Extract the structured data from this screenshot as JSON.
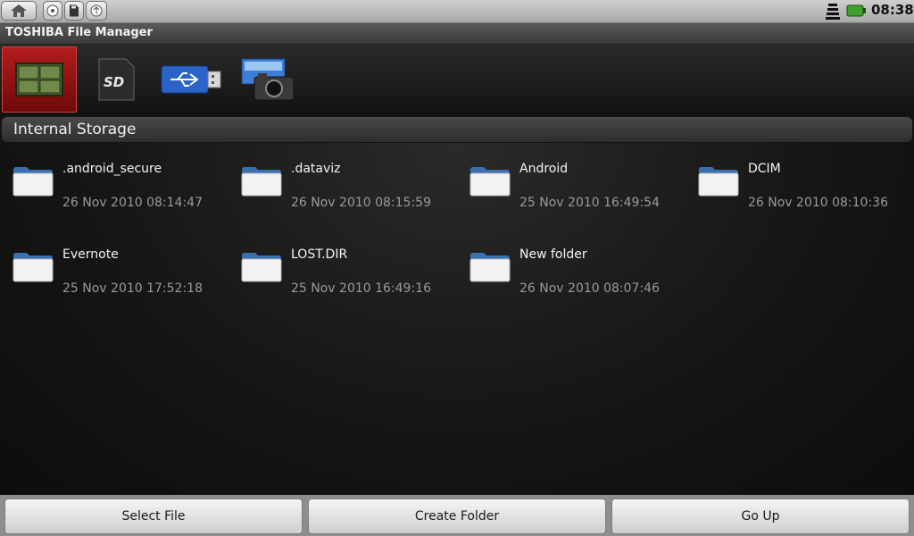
{
  "status_bar": {
    "clock": "08:38",
    "icons": [
      "home-icon",
      "usb-debug-icon",
      "sd-card-icon",
      "usb-connected-icon",
      "wifi-signal-icon",
      "battery-icon"
    ]
  },
  "app": {
    "title": "TOSHIBA File Manager"
  },
  "storage_tabs": [
    {
      "name": "internal-storage",
      "icon": "memory-chip-icon",
      "selected": true
    },
    {
      "name": "sd-card",
      "icon": "sd-card-icon",
      "selected": false
    },
    {
      "name": "usb-storage",
      "icon": "usb-drive-icon",
      "selected": false
    },
    {
      "name": "camera-storage",
      "icon": "camera-icon",
      "selected": false
    }
  ],
  "section": {
    "title": "Internal Storage"
  },
  "files": [
    {
      "name": ".android_secure",
      "date": "26 Nov 2010 08:14:47"
    },
    {
      "name": ".dataviz",
      "date": "26 Nov 2010 08:15:59"
    },
    {
      "name": "Android",
      "date": "25 Nov 2010 16:49:54"
    },
    {
      "name": "DCIM",
      "date": "26 Nov 2010 08:10:36"
    },
    {
      "name": "Evernote",
      "date": "25 Nov 2010 17:52:18"
    },
    {
      "name": "LOST.DIR",
      "date": "25 Nov 2010 16:49:16"
    },
    {
      "name": "New folder",
      "date": "26 Nov 2010 08:07:46"
    }
  ],
  "buttons": {
    "select_file": "Select File",
    "create_folder": "Create Folder",
    "go_up": "Go Up"
  },
  "colors": {
    "selected_tab": "#b31c1c",
    "folder_tab": "#3a6fb0",
    "background": "#141414"
  }
}
